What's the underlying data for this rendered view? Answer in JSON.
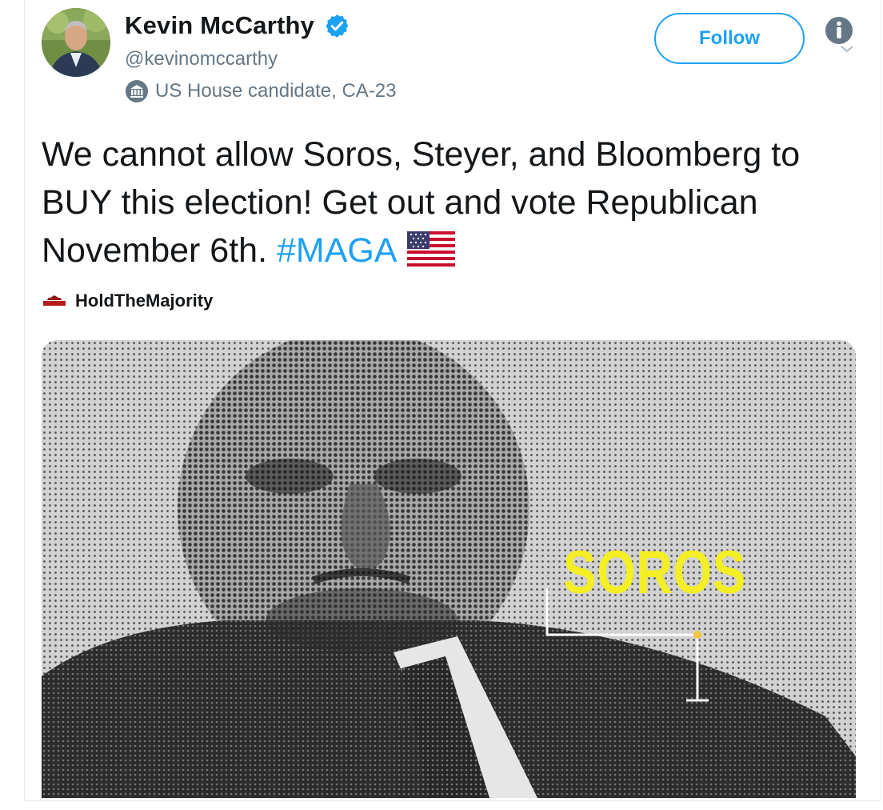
{
  "user": {
    "name": "Kevin McCarthy",
    "handle": "@kevinomccarthy",
    "label": "US House candidate, CA-23",
    "verified_icon": "verified-badge-icon",
    "label_icon": "government-building-icon"
  },
  "actions": {
    "follow_label": "Follow"
  },
  "tweet": {
    "text_before_hashtag": "We cannot allow Soros, Steyer, and Bloomberg to BUY this election! Get out and vote Republican November 6th.",
    "hashtag": "#MAGA",
    "emoji": "us-flag-emoji"
  },
  "card_source": {
    "name": "HoldTheMajority",
    "logo": "hold-the-majority-logo"
  },
  "media": {
    "overlay_text": "SOROS",
    "overlay_color": "#f4ee25"
  },
  "colors": {
    "accent": "#1da1f2",
    "text": "#14171a",
    "muted": "#657786"
  }
}
